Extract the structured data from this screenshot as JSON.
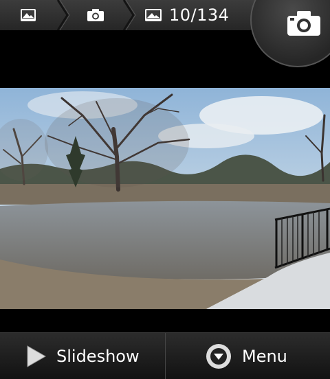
{
  "breadcrumb": {
    "items": [
      {
        "icon": "picture-icon"
      },
      {
        "icon": "camera-icon"
      },
      {
        "icon": "picture-icon",
        "count": "10/134"
      }
    ]
  },
  "camera_shortcut": {
    "icon": "camera-icon"
  },
  "photo": {
    "subject": ""
  },
  "actions": {
    "slideshow_label": "Slideshow",
    "menu_label": "Menu"
  }
}
